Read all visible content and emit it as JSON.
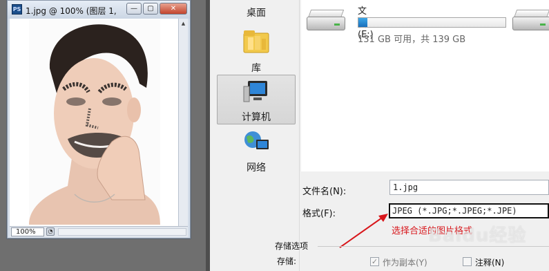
{
  "ps_window": {
    "app_icon": "PS",
    "title": "1.jpg @ 100% (图层 1, ",
    "zoom": "100%",
    "controls": {
      "minimize": "—",
      "maximize": "▢",
      "close": "✕"
    }
  },
  "nav": {
    "items": [
      {
        "label": "桌面",
        "icon": "desktop-icon"
      },
      {
        "label": "库",
        "icon": "library-folder-icon"
      },
      {
        "label": "计算机",
        "icon": "computer-icon",
        "selected": true
      },
      {
        "label": "网络",
        "icon": "network-icon"
      }
    ]
  },
  "drives": [
    {
      "name": "文档 (E:)",
      "info": "131 GB 可用，共 139 GB",
      "used_fraction": 0.06,
      "icon": "hard-drive-icon"
    }
  ],
  "save_form": {
    "filename_label": "文件名(N):",
    "filename_value": "1.jpg",
    "format_label": "格式(F):",
    "format_value": "JPEG (*.JPG;*.JPEG;*.JPE)",
    "annotation": "选择合适的图片格式",
    "annotation_color": "#d8161b"
  },
  "options": {
    "section_title": "存储选项",
    "store_label": "存储:",
    "as_copy_label": "作为副本(Y)",
    "as_copy_checked": true,
    "notes_label": "注释(N)",
    "notes_checked": false
  },
  "watermark": "Baidu经验"
}
